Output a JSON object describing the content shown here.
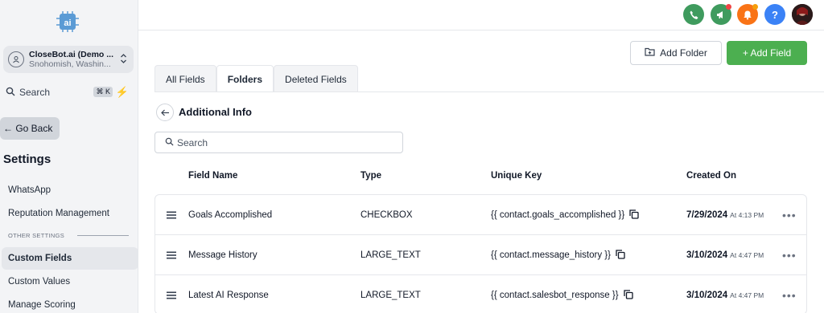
{
  "sidebar": {
    "logo_text": "ai",
    "account": {
      "name": "CloseBot.ai (Demo ...",
      "location": "Snohomish, Washin..."
    },
    "search": {
      "label": "Search",
      "shortcut": "⌘ K"
    },
    "go_back": "← Go Back",
    "settings_title": "Settings",
    "items": [
      {
        "label": "WhatsApp"
      },
      {
        "label": "Reputation Management"
      }
    ],
    "other_settings_label": "OTHER SETTINGS",
    "other_items": [
      {
        "label": "Custom Fields",
        "active": true
      },
      {
        "label": "Custom Values"
      },
      {
        "label": "Manage Scoring"
      }
    ]
  },
  "topbar": {
    "icons": [
      {
        "name": "phone-icon",
        "color": "#3f9b5e"
      },
      {
        "name": "megaphone-icon",
        "color": "#3f9b5e"
      },
      {
        "name": "bell-icon",
        "color": "#f97316"
      },
      {
        "name": "help-icon",
        "color": "#3b82f6",
        "glyph": "?"
      },
      {
        "name": "avatar"
      }
    ]
  },
  "toolbar": {
    "add_folder": "Add Folder",
    "add_field": "+ Add Field"
  },
  "tabs": [
    {
      "label": "All Fields"
    },
    {
      "label": "Folders",
      "active": true
    },
    {
      "label": "Deleted Fields"
    }
  ],
  "folder": {
    "title": "Additional Info"
  },
  "search": {
    "placeholder": "Search"
  },
  "table": {
    "headers": {
      "name": "Field Name",
      "type": "Type",
      "key": "Unique Key",
      "created": "Created On"
    },
    "rows": [
      {
        "name": "Goals Accomplished",
        "type": "CHECKBOX",
        "key": "{{ contact.goals_accomplished }}",
        "date": "7/29/2024",
        "time": "At 4:13 PM"
      },
      {
        "name": "Message History",
        "type": "LARGE_TEXT",
        "key": "{{ contact.message_history }}",
        "date": "3/10/2024",
        "time": "At 4:47 PM"
      },
      {
        "name": "Latest AI Response",
        "type": "LARGE_TEXT",
        "key": "{{ contact.salesbot_response }}",
        "date": "3/10/2024",
        "time": "At 4:47 PM"
      }
    ]
  },
  "colors": {
    "accent_green": "#4caf50",
    "bell_orange": "#f97316",
    "help_blue": "#3b82f6"
  }
}
